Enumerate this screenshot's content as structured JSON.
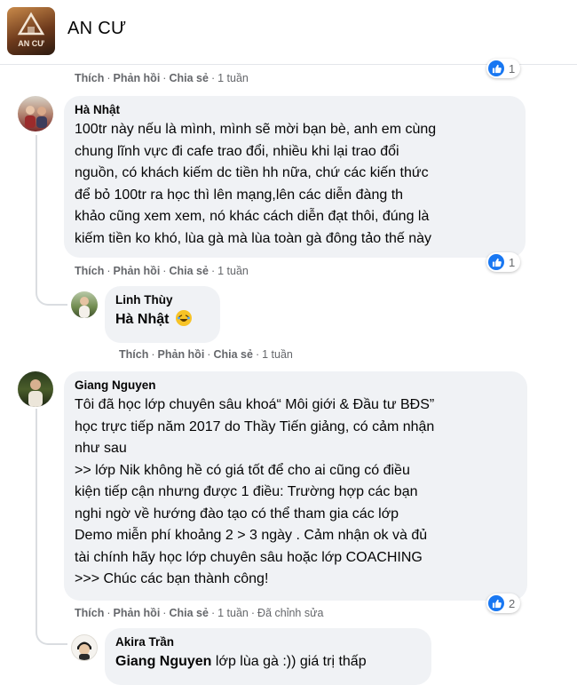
{
  "page": {
    "name": "AN CƯ",
    "logo_text": "AN CƯ"
  },
  "action_labels": {
    "like": "Thích",
    "reply": "Phản hồi",
    "share": "Chia sẻ",
    "dot": "·"
  },
  "top_actions": {
    "time": "1 tuần",
    "reaction_count": "1"
  },
  "comments": [
    {
      "author": "Hà Nhật",
      "text": "100tr này nếu là mình, mình sẽ mời bạn bè, anh em cùng\nchung lĩnh vực đi cafe trao đổi, nhiều khi lại trao đổi\nnguồn, có khách kiếm dc tiền hh nữa, chứ các kiến thức\nđể bỏ 100tr ra học thì lên mạng,lên các diễn đàng th\nkhảo cũng xem xem, nó khác cách diễn đạt thôi, đúng là\nkiếm tiền ko khó, lùa gà mà lùa toàn gà đông tảo thế này",
      "time": "1 tuần",
      "reaction_count": "1",
      "reaction_icon": "like-icon",
      "reply": {
        "author": "Linh Thùy",
        "mention": "Hà Nhật",
        "text": "",
        "emoji": "laughing-emoji",
        "time": "1 tuần"
      }
    },
    {
      "author": "Giang Nguyen",
      "text": "Tôi đã học lớp chuyên sâu khoá“ Môi giới & Đầu tư BĐS”\nhọc trực tiếp năm 2017 do Thầy Tiến giảng, có cảm nhận\nnhư sau\n>> lớp Nik không hề có giá tốt để cho ai cũng có điều\nkiện tiếp cận nhưng được 1 điều: Trường hợp các bạn\nnghi ngờ về hướng đào tạo có thể tham gia các lớp\nDemo miễn phí khoảng 2 > 3 ngày . Cảm nhận ok và đủ\ntài chính hãy học lớp chuyên sâu hoặc lớp COACHING\n>>> Chúc các bạn thành công!",
      "time": "1 tuần",
      "edited": "Đã chỉnh sửa",
      "reaction_count": "2",
      "reaction_icon": "like-icon",
      "reply": {
        "author": "Akira Trần",
        "mention": "Giang Nguyen",
        "text": " lớp lùa gà :)) giá trị thấp"
      }
    }
  ],
  "colors": {
    "accent": "#1877f2",
    "bubble": "#f0f2f5",
    "meta": "#65676b",
    "thread": "#dadde1"
  }
}
